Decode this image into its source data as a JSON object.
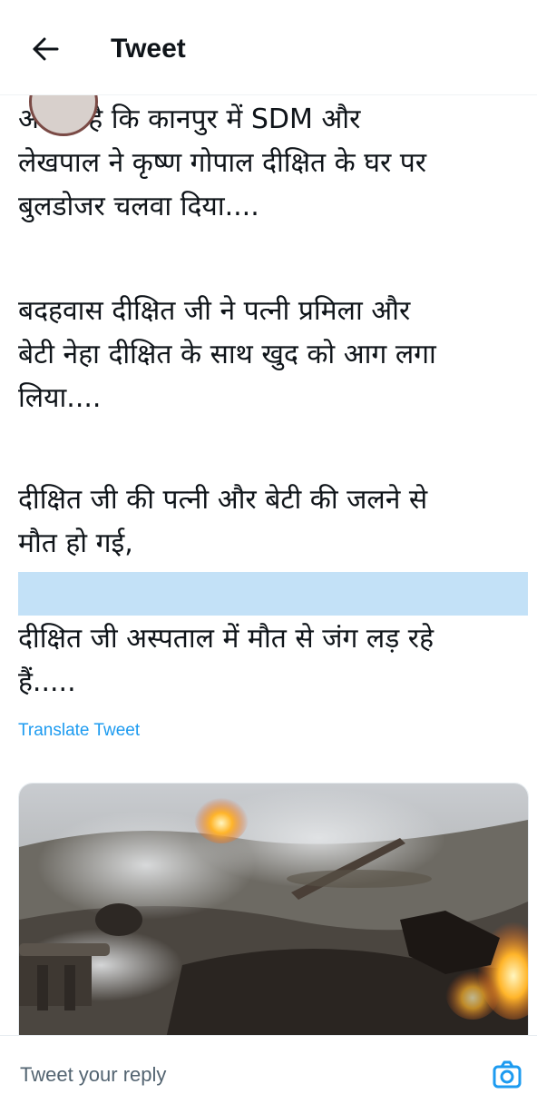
{
  "header": {
    "back_icon": "arrow-left-icon",
    "title": "Tweet"
  },
  "tweet": {
    "paragraphs": [
      "आरोप है कि कानपुर में SDM और\nलेखपाल ने कृष्ण गोपाल दीक्षित के घर पर\nबुलडोजर चलवा दिया....",
      "बदहवास दीक्षित जी ने पत्नी प्रमिला और\nबेटी नेहा दीक्षित के साथ खुद को आग लगा\nलिया....",
      "दीक्षित जी की पत्नी और बेटी की जलने से\nमौत हो गई,",
      "दीक्षित जी अस्पताल में मौत से जंग लड़ रहे\nहैं....."
    ],
    "translate_label": "Translate Tweet",
    "media_description_icon": "photo-burning-debris"
  },
  "reply": {
    "placeholder": "Tweet your reply",
    "camera_icon": "camera-icon",
    "accent": "#1d9bf0"
  },
  "colors": {
    "highlight": "#c3e1f7",
    "link": "#1d9bf0",
    "text": "#0f1419"
  }
}
